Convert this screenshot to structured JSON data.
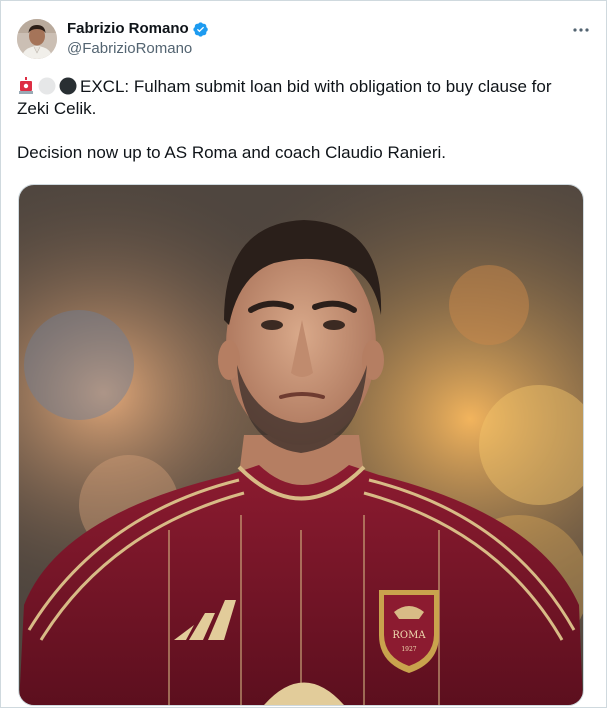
{
  "author": {
    "display_name": "Fabrizio Romano",
    "handle": "@FabrizioRomano",
    "verified": true,
    "avatar_icon": "profile-photo"
  },
  "menu": {
    "icon": "more-horizontal-icon"
  },
  "tweet": {
    "emoji": [
      "siren-emoji",
      "white-circle-emoji",
      "black-circle-emoji"
    ],
    "line1": "EXCL: Fulham submit loan bid with obligation to buy clause for Zeki Celik.",
    "line2": "Decision now up to AS Roma and coach Claudio Ranieri."
  },
  "media": {
    "description_icon": "player-photo",
    "crest_text": "ROMA",
    "crest_year": "1927"
  },
  "colors": {
    "text": "#0f1419",
    "secondary": "#536471",
    "verified": "#1d9bf0",
    "border": "#cfd9de",
    "jersey": "#7a1628"
  }
}
